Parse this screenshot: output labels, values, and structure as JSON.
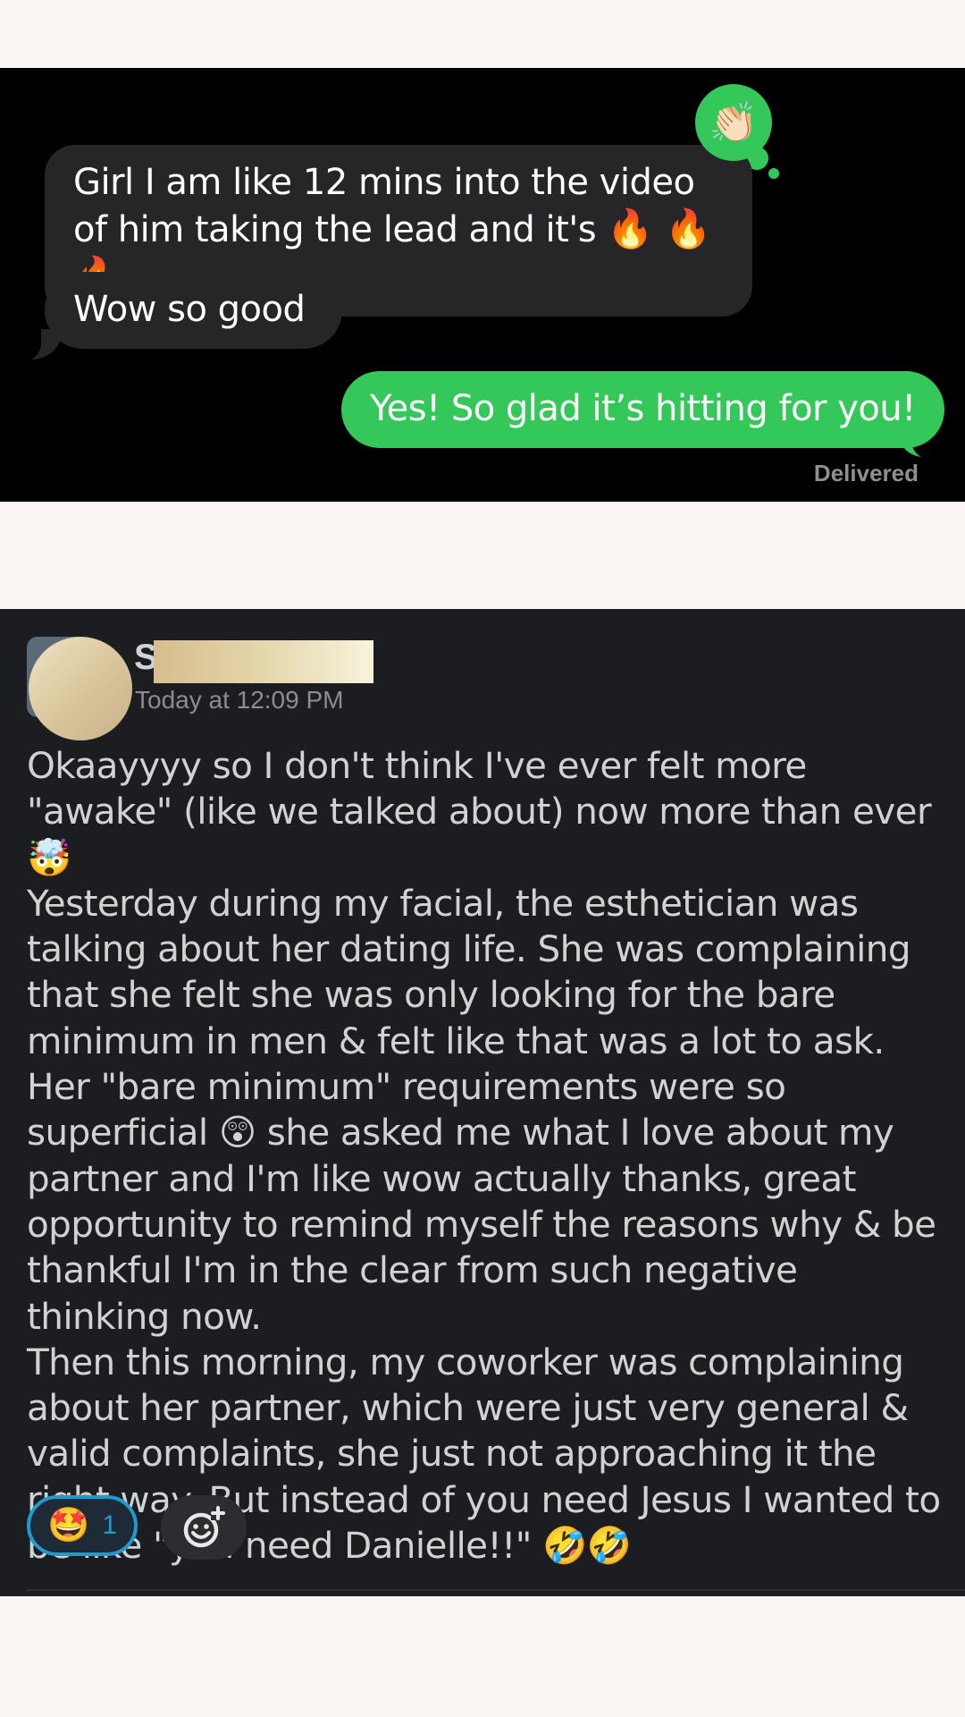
{
  "imessage": {
    "tapback_emoji": "👏🏻",
    "messages": [
      {
        "direction": "incoming",
        "text": "Girl I am like 12 mins into the video of him taking the lead and it's",
        "emojis": "🔥 🔥🔥"
      },
      {
        "direction": "incoming",
        "text": "Wow so good"
      },
      {
        "direction": "outgoing",
        "text": "Yes! So glad it’s hitting for you!"
      }
    ],
    "status": "Delivered"
  },
  "post": {
    "author_initial": "S",
    "timestamp": "Today at 12:09 PM",
    "paragraphs": [
      "Okaayyyy so I don't think I've ever felt more \"awake\" (like we talked about) now more than ever 🤯",
      "Yesterday during my facial, the esthetician was talking about her dating life. She was complaining that she felt she was only looking for the bare minimum in men & felt like that was a lot to ask. Her \"bare minimum\" requirements were so superficial 😲 she asked me what I love about my partner and I'm like wow actually thanks, great opportunity to remind myself the reasons why & be thankful I'm in the clear from such negative thinking now.",
      "Then this morning, my coworker was complaining about her partner, which were just very general & valid complaints, she just not approaching it the right way. But instead of you need Jesus I wanted to be like \"you need Danielle!!\" 🤣🤣"
    ],
    "reaction": {
      "emoji": "🤩",
      "count": "1"
    },
    "add_reaction_icon": "add-emoji-icon"
  },
  "colors": {
    "incoming_bubble": "#262628",
    "outgoing_bubble": "#34c759",
    "post_background": "#1c1d21",
    "reaction_accent": "#1d9bd1"
  }
}
